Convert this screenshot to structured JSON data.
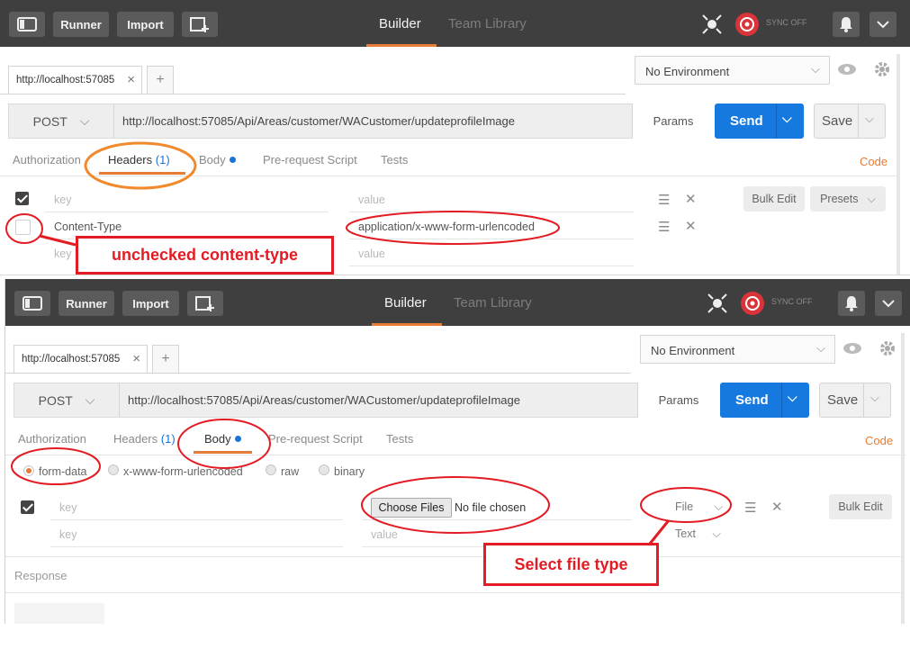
{
  "topbar": {
    "runner_label": "Runner",
    "import_label": "Import",
    "builder_tab": "Builder",
    "team_library_tab": "Team Library",
    "sync_status": "SYNC OFF"
  },
  "request_tab": {
    "title": "http://localhost:57085"
  },
  "environment": {
    "selected": "No Environment"
  },
  "request": {
    "method": "POST",
    "url": "http://localhost:57085/Api/Areas/customer/WACustomer/updateprofileImage",
    "params_label": "Params",
    "send_label": "Send",
    "save_label": "Save"
  },
  "subtabs": {
    "authorization": "Authorization",
    "headers": "Headers",
    "headers_count": "(1)",
    "body": "Body",
    "prerequest": "Pre-request Script",
    "tests": "Tests",
    "code": "Code"
  },
  "headers_editor": {
    "key_placeholder": "key",
    "value_placeholder": "value",
    "rows": [
      {
        "key": "Content-Type",
        "value": "application/x-www-form-urlencoded",
        "checked": false
      }
    ],
    "bulk_edit": "Bulk Edit",
    "presets": "Presets"
  },
  "body_editor": {
    "modes": [
      "form-data",
      "x-www-form-urlencoded",
      "raw",
      "binary"
    ],
    "selected_mode": "form-data",
    "choose_files": "Choose Files",
    "no_file": "No file chosen",
    "type_file": "File",
    "type_text": "Text",
    "key_placeholder": "key",
    "value_placeholder": "value",
    "bulk_edit": "Bulk Edit"
  },
  "response": {
    "label": "Response"
  },
  "annotations": {
    "unchecked": "unchecked content-type",
    "select_file": "Select file type",
    "color": "#e31b23",
    "highlight_color": "#f08a2c"
  },
  "colors": {
    "accent": "#e67c35",
    "send_blue": "#1579e0",
    "topbar": "#3f3f3f"
  }
}
